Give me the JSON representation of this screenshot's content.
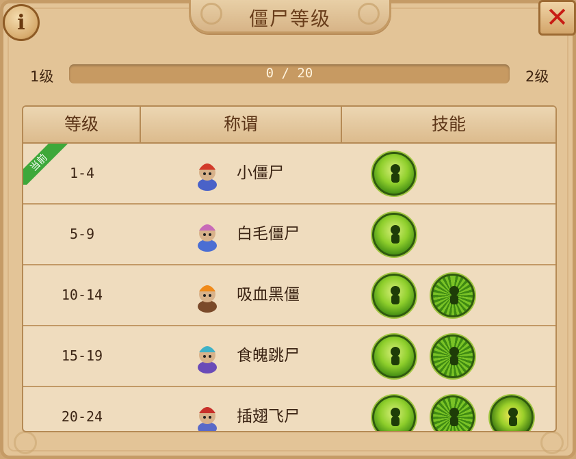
{
  "header": {
    "title": "僵尸等级",
    "info_icon": "info-icon",
    "close_icon": "close-icon"
  },
  "level": {
    "current": "1级",
    "next": "2级",
    "progress_text": "0 / 20",
    "progress": 0.0
  },
  "table": {
    "headers": [
      "等级",
      "称谓",
      "技能"
    ],
    "current_badge": "当前",
    "rows": [
      {
        "range": "1-4",
        "name": "小僵尸",
        "avatar": "zombie-red-hat",
        "skills": [
          "skill-green-sprite"
        ]
      },
      {
        "range": "5-9",
        "name": "白毛僵尸",
        "avatar": "zombie-blue-hair",
        "skills": [
          "skill-green-sprite"
        ]
      },
      {
        "range": "10-14",
        "name": "吸血黑僵",
        "avatar": "zombie-flame-hair",
        "skills": [
          "skill-green-sprite",
          "skill-green-burst"
        ]
      },
      {
        "range": "15-19",
        "name": "食魄跳尸",
        "avatar": "zombie-purple",
        "skills": [
          "skill-green-sprite",
          "skill-green-burst"
        ]
      },
      {
        "range": "20-24",
        "name": "插翅飞尸",
        "avatar": "zombie-winged",
        "skills": [
          "skill-green-sprite",
          "skill-green-burst",
          "skill-green-demon"
        ]
      }
    ]
  },
  "colors": {
    "panel": "#e3c497",
    "bar": "#c79a62",
    "badge": "#3ea83a",
    "close": "#c81c14"
  }
}
